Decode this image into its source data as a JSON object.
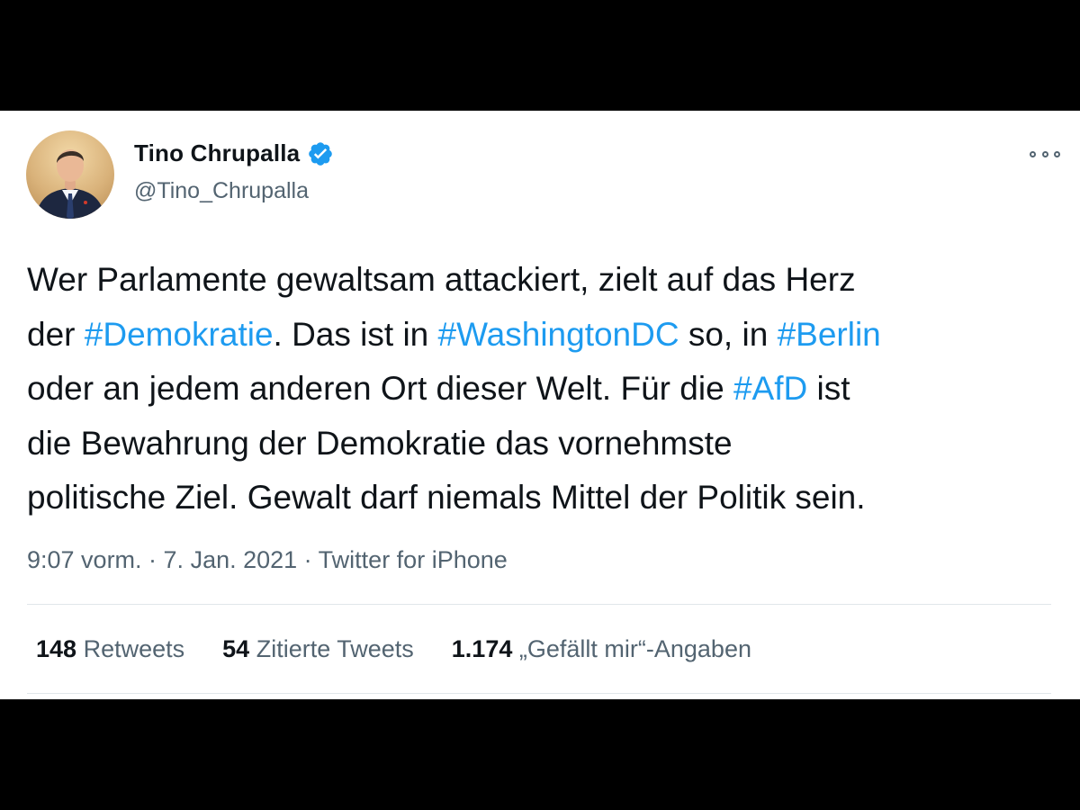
{
  "author": {
    "name": "Tino Chrupalla",
    "handle": "@Tino_Chrupalla"
  },
  "icons": {
    "verified": "verified-badge-icon",
    "more": "more-options-icon"
  },
  "colors": {
    "hashtag": "#1d9bf0",
    "verified": "#1d9bf0",
    "text": "#0f1419",
    "secondary": "#536471"
  },
  "tweet": {
    "lines": [
      [
        {
          "t": "Wer Parlamente gewaltsam attackiert, zielt auf das Herz"
        }
      ],
      [
        {
          "t": "der "
        },
        {
          "t": "#Demokratie",
          "tag": true
        },
        {
          "t": ". Das ist in "
        },
        {
          "t": "#WashingtonDC",
          "tag": true
        },
        {
          "t": " so, in "
        },
        {
          "t": "#Berlin",
          "tag": true
        }
      ],
      [
        {
          "t": "oder an jedem anderen Ort dieser Welt. Für die "
        },
        {
          "t": "#AfD",
          "tag": true
        },
        {
          "t": " ist"
        }
      ],
      [
        {
          "t": "die Bewahrung der Demokratie das vornehmste"
        }
      ],
      [
        {
          "t": "politische Ziel. Gewalt darf niemals Mittel der Politik sein."
        }
      ]
    ]
  },
  "meta": {
    "text": "9:07 vorm. · 7. Jan. 2021 · Twitter for iPhone"
  },
  "stats": {
    "retweets_count": "148",
    "retweets_label": "Retweets",
    "quotes_count": "54",
    "quotes_label": "Zitierte Tweets",
    "likes_count": "1.174",
    "likes_label": "„Gefällt mir“-Angaben"
  }
}
